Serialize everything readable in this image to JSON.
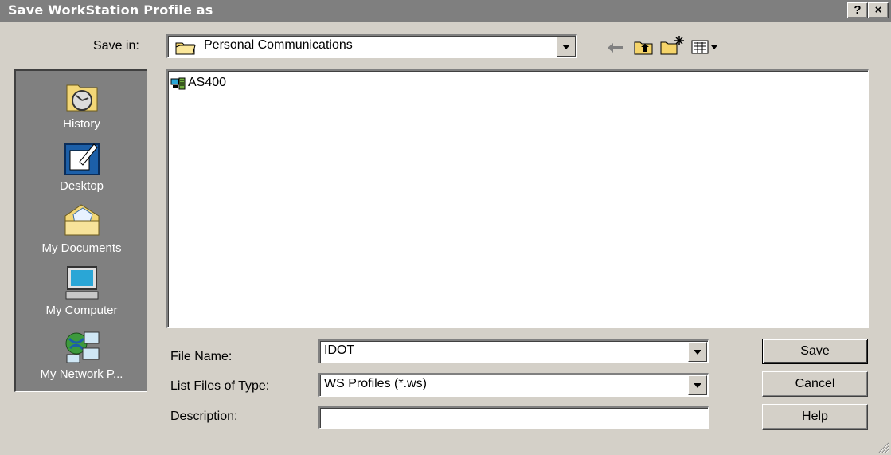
{
  "dialog": {
    "title": "Save WorkStation Profile as",
    "help_button": "?",
    "close_button": "×"
  },
  "save_in": {
    "label": "Save in:",
    "value": "Personal Communications"
  },
  "toolbar": {
    "icons": [
      "back-arrow-icon",
      "up-folder-icon",
      "new-folder-icon",
      "view-menu-icon"
    ]
  },
  "places_bar": {
    "items": [
      {
        "label": "History",
        "icon": "history-icon"
      },
      {
        "label": "Desktop",
        "icon": "desktop-icon"
      },
      {
        "label": "My Documents",
        "icon": "my-documents-icon"
      },
      {
        "label": "My Computer",
        "icon": "my-computer-icon"
      },
      {
        "label": "My Network P...",
        "icon": "my-network-places-icon"
      }
    ]
  },
  "files": [
    {
      "name": "AS400",
      "icon": "workstation-profile-icon"
    }
  ],
  "form": {
    "file_name_label": "File Name:",
    "file_name_value": "IDOT",
    "file_type_label": "List Files of Type:",
    "file_type_value": "WS Profiles (*.ws)",
    "description_label": "Description:",
    "description_value": ""
  },
  "buttons": {
    "save": "Save",
    "cancel": "Cancel",
    "help": "Help"
  },
  "colors": {
    "titlebar": "#7f7f7f",
    "face": "#d4d0c8",
    "places_bg": "#808080"
  }
}
